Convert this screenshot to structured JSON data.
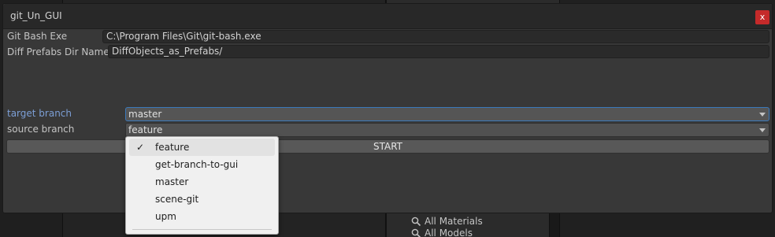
{
  "window": {
    "title": "git_Un_GUI",
    "close_glyph": "x"
  },
  "fields": {
    "git_bash_exe_label": "Git Bash Exe",
    "git_bash_exe_value": "C:\\Program Files\\Git\\git-bash.exe",
    "diff_prefabs_label": "Diff Prefabs Dir Name",
    "diff_prefabs_value": "DiffObjects_as_Prefabs/"
  },
  "branches": {
    "target_label": "target branch",
    "target_value": "master",
    "source_label": "source branch",
    "source_value": "feature"
  },
  "start_button": "START",
  "popup": {
    "check_glyph": "✓",
    "items": [
      "feature",
      "get-branch-to-gui",
      "master",
      "scene-git",
      "upm"
    ],
    "selected_index": 0
  },
  "background": {
    "rows": [
      "All Materials",
      "All Models"
    ]
  },
  "colors": {
    "close": "#c52a2a",
    "focus_border": "#3a79bb",
    "active_label": "#7c9fd6"
  }
}
